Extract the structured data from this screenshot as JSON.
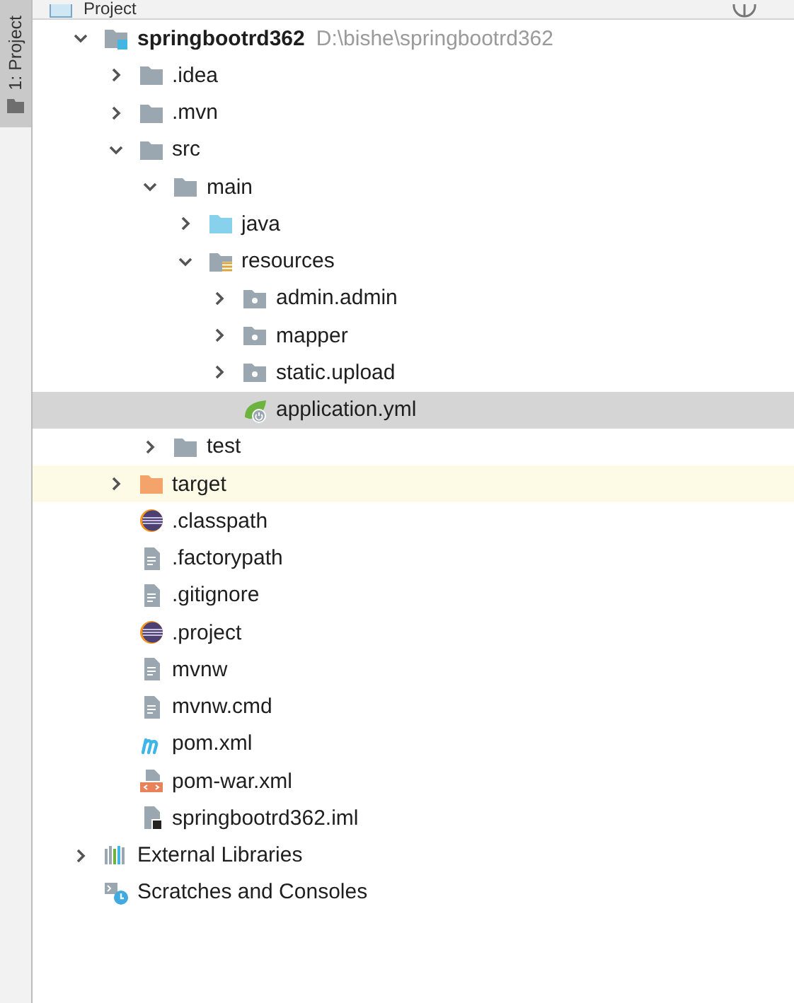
{
  "side_tab": {
    "label": "1: Project",
    "selected": true
  },
  "header": {
    "title": "Project"
  },
  "tree": [
    {
      "name": "springbootrd362",
      "path": "D:\\bishe\\springbootrd362",
      "kind": "module",
      "expanded": true,
      "selected": false,
      "children": [
        {
          "name": ".idea",
          "kind": "folder",
          "expanded": false,
          "selected": false
        },
        {
          "name": ".mvn",
          "kind": "folder",
          "expanded": false,
          "selected": false
        },
        {
          "name": "src",
          "kind": "folder",
          "expanded": true,
          "selected": false,
          "children": [
            {
              "name": "main",
              "kind": "folder",
              "expanded": true,
              "selected": false,
              "children": [
                {
                  "name": "java",
                  "kind": "source",
                  "expanded": false,
                  "selected": false
                },
                {
                  "name": "resources",
                  "kind": "resources",
                  "expanded": true,
                  "selected": false,
                  "children": [
                    {
                      "name": "admin.admin",
                      "kind": "package",
                      "expanded": false,
                      "selected": false
                    },
                    {
                      "name": "mapper",
                      "kind": "package",
                      "expanded": false,
                      "selected": false
                    },
                    {
                      "name": "static.upload",
                      "kind": "package",
                      "expanded": false,
                      "selected": false
                    },
                    {
                      "name": "application.yml",
                      "kind": "spring",
                      "selected": true
                    }
                  ]
                }
              ]
            },
            {
              "name": "test",
              "kind": "folder",
              "expanded": false,
              "selected": false
            }
          ]
        },
        {
          "name": "target",
          "kind": "excluded",
          "expanded": false,
          "selected": false
        },
        {
          "name": ".classpath",
          "kind": "eclipse",
          "selected": false
        },
        {
          "name": ".factorypath",
          "kind": "text",
          "selected": false
        },
        {
          "name": ".gitignore",
          "kind": "text",
          "selected": false
        },
        {
          "name": ".project",
          "kind": "eclipse",
          "selected": false
        },
        {
          "name": "mvnw",
          "kind": "text",
          "selected": false
        },
        {
          "name": "mvnw.cmd",
          "kind": "text",
          "selected": false
        },
        {
          "name": "pom.xml",
          "kind": "maven",
          "selected": false
        },
        {
          "name": "pom-war.xml",
          "kind": "xml",
          "selected": false
        },
        {
          "name": "springbootrd362.iml",
          "kind": "iml",
          "selected": false
        }
      ]
    },
    {
      "name": "External Libraries",
      "kind": "libraries",
      "expanded": false,
      "selected": false
    },
    {
      "name": "Scratches and Consoles",
      "kind": "scratches",
      "selected": false
    }
  ]
}
